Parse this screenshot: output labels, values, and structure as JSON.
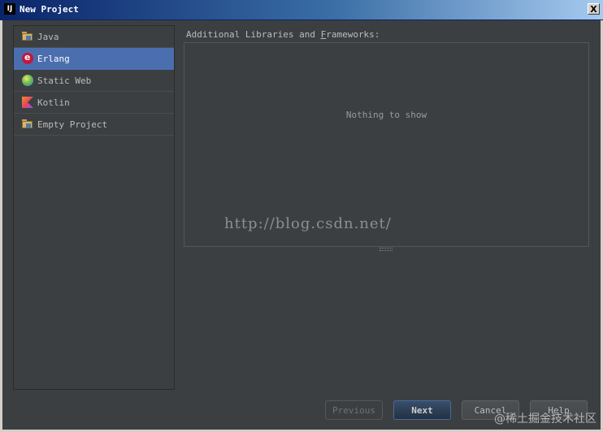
{
  "window": {
    "app_icon_text": "IJ",
    "title": "New Project",
    "close_glyph": "X"
  },
  "sidebar": {
    "items": [
      {
        "label": "Java",
        "icon": "folder-icon",
        "selected": false
      },
      {
        "label": "Erlang",
        "icon": "erlang-icon",
        "selected": true
      },
      {
        "label": "Static Web",
        "icon": "globe-icon",
        "selected": false
      },
      {
        "label": "Kotlin",
        "icon": "kotlin-icon",
        "selected": false
      },
      {
        "label": "Empty Project",
        "icon": "folder-icon",
        "selected": false
      }
    ]
  },
  "main": {
    "libraries_label_pre": "Additional Libraries and ",
    "libraries_label_underlined": "F",
    "libraries_label_post": "rameworks:",
    "empty_text": "Nothing to show",
    "watermark": "http://blog.csdn.net/"
  },
  "buttons": {
    "previous": "Previous",
    "next": "Next",
    "cancel": "Cancel",
    "help": "Help"
  },
  "footer_watermark": "@稀土掘金技术社区",
  "colors": {
    "background": "#3c3f41",
    "selection": "#4b6eaf",
    "titlebar_start": "#0a246a"
  }
}
